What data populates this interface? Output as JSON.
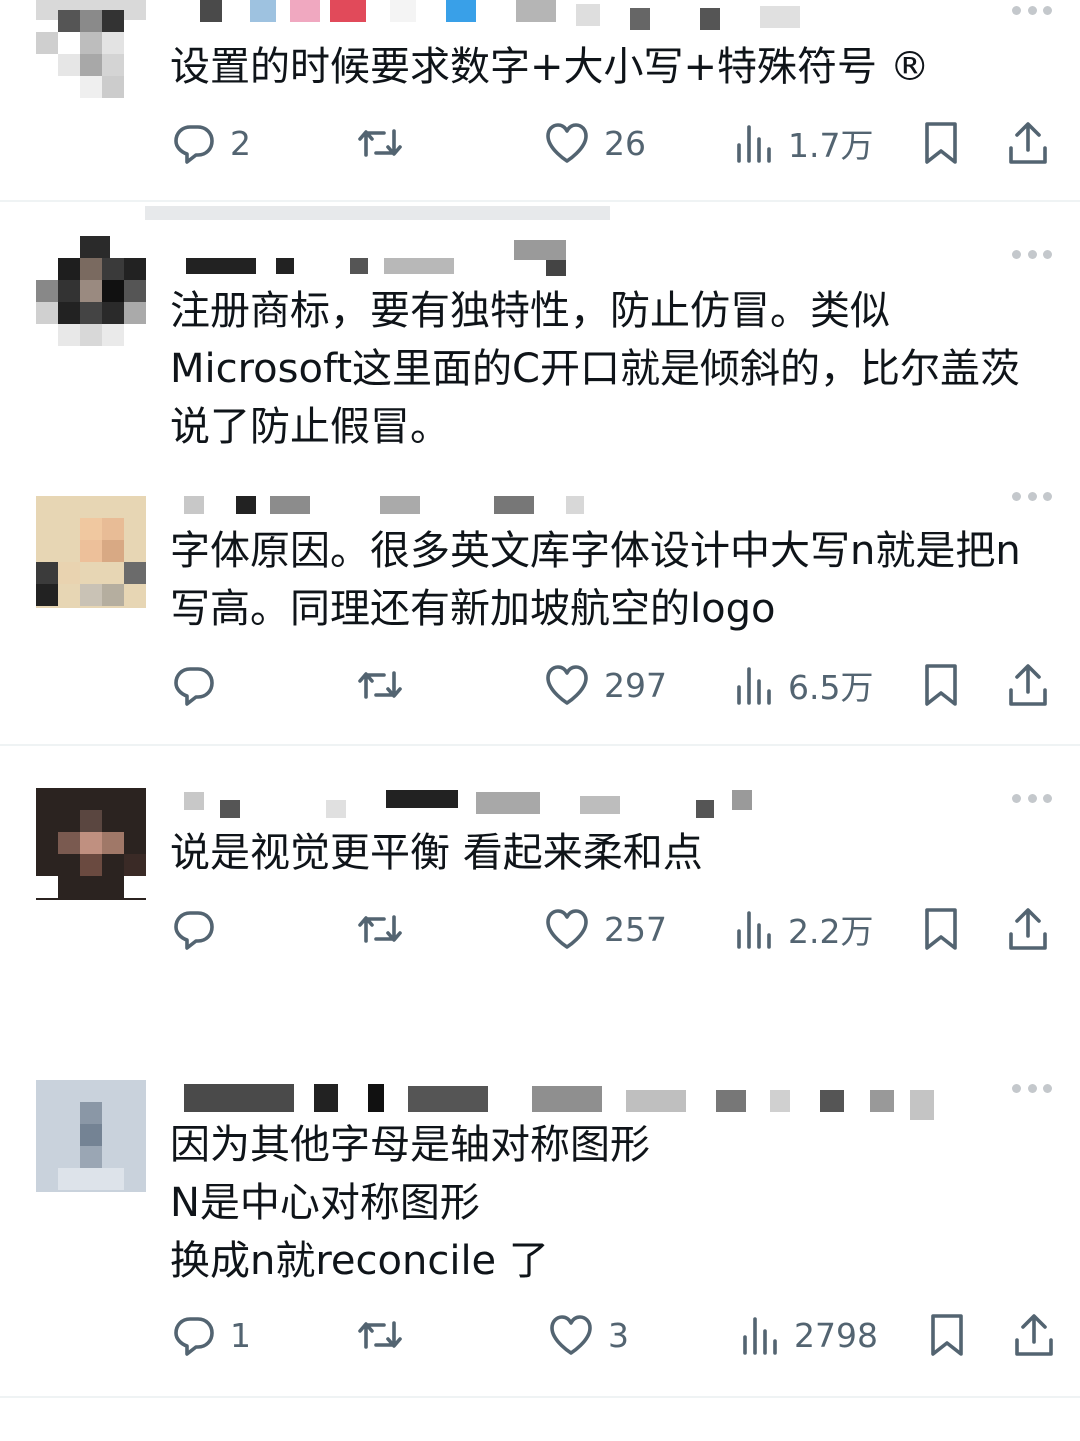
{
  "posts": [
    {
      "text": "设置的时候要求数字+大小写+特殊符号 ®",
      "replies": "2",
      "retweets": "",
      "likes": "26",
      "views": "1.7万"
    },
    {
      "text": "注册商标，要有独特性，防止仿冒。类似\nMicrosoft这里面的C开口就是倾斜的，比尔盖茨\n说了防止假冒。"
    },
    {
      "text": "字体原因。很多英文库字体设计中大写n就是把n\n写高。同理还有新加坡航空的logo",
      "replies": "",
      "retweets": "",
      "likes": "297",
      "views": "6.5万"
    },
    {
      "text": "说是视觉更平衡 看起来柔和点",
      "replies": "",
      "retweets": "",
      "likes": "257",
      "views": "2.2万"
    },
    {
      "text": "因为其他字母是轴对称图形\nN是中心对称图形\n换成n就reconcile 了",
      "replies": "1",
      "retweets": "",
      "likes": "3",
      "views": "2798"
    }
  ],
  "icons": {
    "reply": "reply-icon",
    "retweet": "retweet-icon",
    "like": "heart-icon",
    "views": "views-icon",
    "bookmark": "bookmark-icon",
    "share": "share-icon",
    "more": "more-icon"
  },
  "colors": {
    "text": "#0f1419",
    "muted": "#536471",
    "divider": "#eff3f4"
  }
}
